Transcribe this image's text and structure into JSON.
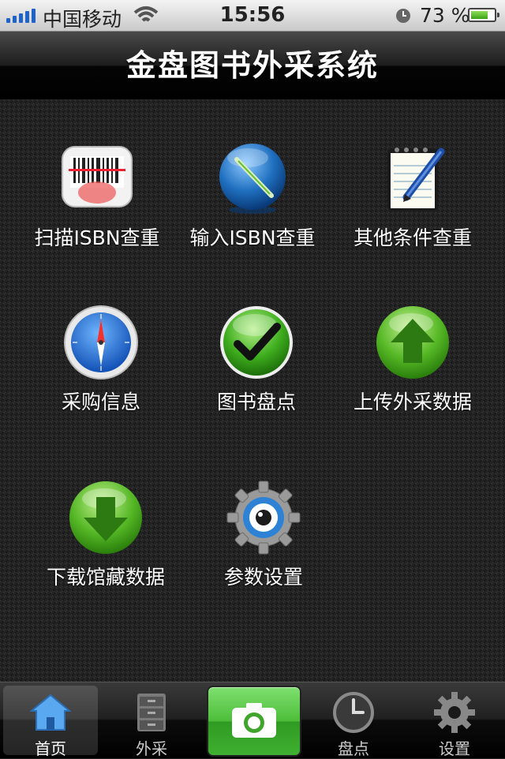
{
  "status_bar": {
    "carrier": "中国移动",
    "time": "15:56",
    "battery_percent": "73 %",
    "battery_level": 0.73,
    "icons": [
      "signal-icon",
      "wifi-icon",
      "alarm-icon",
      "battery-icon"
    ]
  },
  "header": {
    "title": "金盘图书外采系统"
  },
  "menu": [
    {
      "label": "扫描ISBN查重",
      "icon": "barcode-scanner-icon"
    },
    {
      "label": "输入ISBN查重",
      "icon": "pen-globe-icon"
    },
    {
      "label": "其他条件查重",
      "icon": "notepad-pen-icon"
    },
    {
      "label": "采购信息",
      "icon": "compass-icon"
    },
    {
      "label": "图书盘点",
      "icon": "checkmark-icon"
    },
    {
      "label": "上传外采数据",
      "icon": "upload-arrow-icon"
    },
    {
      "label": "下载馆藏数据",
      "icon": "download-arrow-icon"
    },
    {
      "label": "参数设置",
      "icon": "gear-eye-icon"
    }
  ],
  "tabbar": {
    "tabs": [
      {
        "label": "首页",
        "icon": "home-icon",
        "active": true
      },
      {
        "label": "外采",
        "icon": "cabinet-icon",
        "active": false
      },
      {
        "label": "",
        "icon": "camera-icon",
        "active": false
      },
      {
        "label": "盘点",
        "icon": "clock-icon",
        "active": false
      },
      {
        "label": "设置",
        "icon": "gear-icon",
        "active": false
      }
    ]
  },
  "colors": {
    "accent_green": "#4dbd3a",
    "signal_blue": "#1e64c8"
  }
}
